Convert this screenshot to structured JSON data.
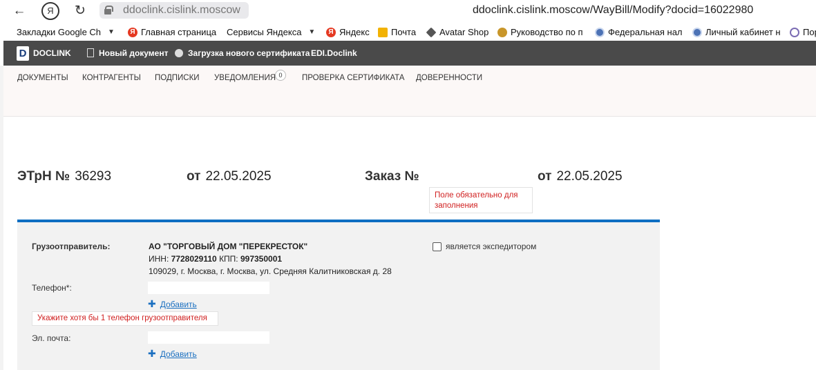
{
  "browser": {
    "domain_chip": "ddoclink.cislink.moscow",
    "full_url": "ddoclink.cislink.moscow/WayBill/Modify?docid=16022980",
    "back_icon": "←",
    "yandex_icon": "Я",
    "reload_icon": "↻"
  },
  "bookmarks": [
    {
      "label": "Закладки Google Ch",
      "icon": "chevron-down-icon"
    },
    {
      "label": "Главная страница",
      "icon": "yandex-icon"
    },
    {
      "label": "Сервисы Яндекса",
      "icon": "chevron-down-icon"
    },
    {
      "label": "Яндекс",
      "icon": "yandex-icon"
    },
    {
      "label": "Почта",
      "icon": "mail-icon"
    },
    {
      "label": "Avatar Shop",
      "icon": "avatar-icon"
    },
    {
      "label": "Руководство по п",
      "icon": "gear-icon"
    },
    {
      "label": "Федеральная нал",
      "icon": "gov-icon"
    },
    {
      "label": "Личный кабинет н",
      "icon": "gov-icon"
    },
    {
      "label": "Пор",
      "icon": "portal-icon"
    }
  ],
  "app_header": {
    "logo_letter": "D",
    "brand": "DOCLINK",
    "new_doc": "Новый документ",
    "upload_cert": "Загрузка нового сертификата",
    "edi": "EDI.Doclink"
  },
  "nav": {
    "documents": "ДОКУМЕНТЫ",
    "counterparties": "КОНТРАГЕНТЫ",
    "signatures": "ПОДПИСКИ",
    "notifications": "УВЕДОМЛЕНИЯ",
    "notifications_count": "0",
    "cert_check": "ПРОВЕРКА СЕРТИФИКАТА",
    "poa": "ДОВЕРЕННОСТИ"
  },
  "doc": {
    "etrn_label": "ЭТрН №",
    "etrn_number": "36293",
    "from_label": "от",
    "etrn_date": "22.05.2025",
    "order_label": "Заказ №",
    "order_number": "",
    "order_from_label": "от",
    "order_date": "22.05.2025",
    "order_error": "Поле обязательно для заполнения"
  },
  "shipper": {
    "label": "Грузоотправитель:",
    "name": "АО \"ТОРГОВЫЙ ДОМ \"ПЕРЕКРЕСТОК\"",
    "inn_label": "ИНН:",
    "inn": "7728029110",
    "kpp_label": "КПП:",
    "kpp": "997350001",
    "address": "109029, г. Москва, г. Москва, ул. Средняя Калитниковская д. 28",
    "forwarder_label": "является экспедитором",
    "forwarder_checked": false,
    "phone_label": "Телефон*:",
    "phone_value": "",
    "add_label": "Добавить",
    "phone_error": "Укажите хотя бы 1 телефон грузоотправителя",
    "email_label": "Эл. почта:",
    "email_value": "",
    "add_label_2": "Добавить"
  },
  "colors": {
    "accent": "#0e6ec2",
    "header_bg": "#4a4a4a",
    "error": "#d02020",
    "link": "#1a6fc0"
  }
}
